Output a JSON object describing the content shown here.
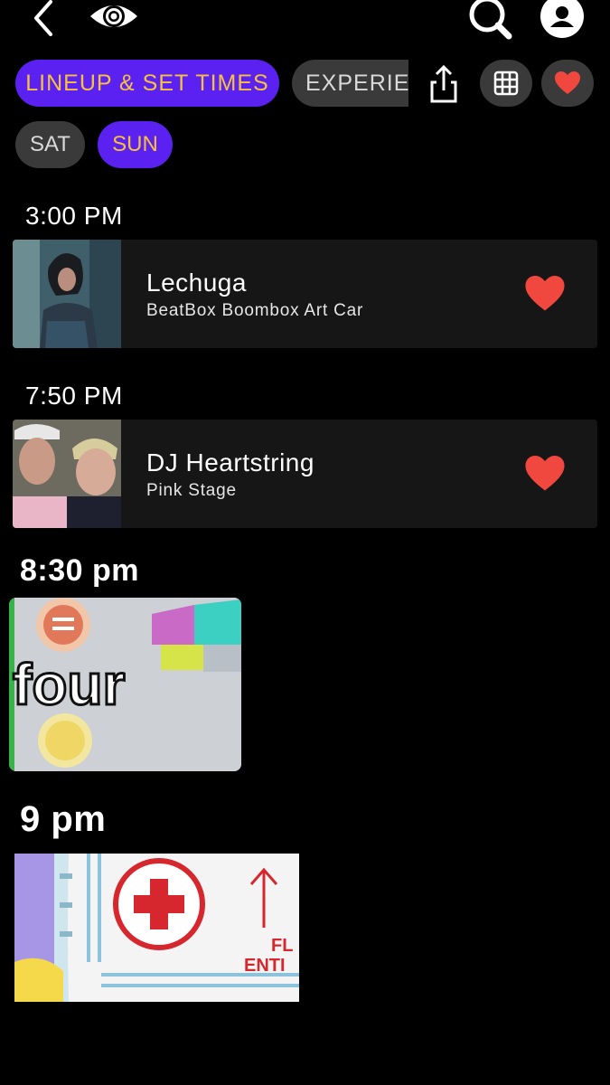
{
  "top_bar": {
    "back_icon": "chevron-left-icon",
    "logo_icon": "eye-logo-icon",
    "search_icon": "search-icon",
    "profile_icon": "profile-icon"
  },
  "tabs": [
    {
      "label": "LINEUP & SET TIMES",
      "active": true
    },
    {
      "label": "EXPERIEN",
      "active": false
    }
  ],
  "actions": {
    "share_icon": "share-icon",
    "grid_icon": "grid-icon",
    "favorites_icon": "heart-icon"
  },
  "days": [
    {
      "label": "SAT",
      "active": false
    },
    {
      "label": "SUN",
      "active": true
    }
  ],
  "schedule": [
    {
      "time": "3:00 PM",
      "artist": "Lechuga",
      "stage": "BeatBox Boombox Art Car",
      "favorited": true
    },
    {
      "time": "7:50 PM",
      "artist": "DJ Heartstring",
      "stage": "Pink Stage",
      "favorited": true
    }
  ],
  "annotations": [
    {
      "time": "8:30 pm",
      "image_text": "four"
    },
    {
      "time": "9 pm",
      "image_text": "FL ENTI"
    }
  ],
  "colors": {
    "accent": "#5b21f0",
    "active_text": "#f6c23e",
    "heart": "#f0483e",
    "card_bg": "#161616",
    "pill_inactive": "#3a3a3a"
  }
}
